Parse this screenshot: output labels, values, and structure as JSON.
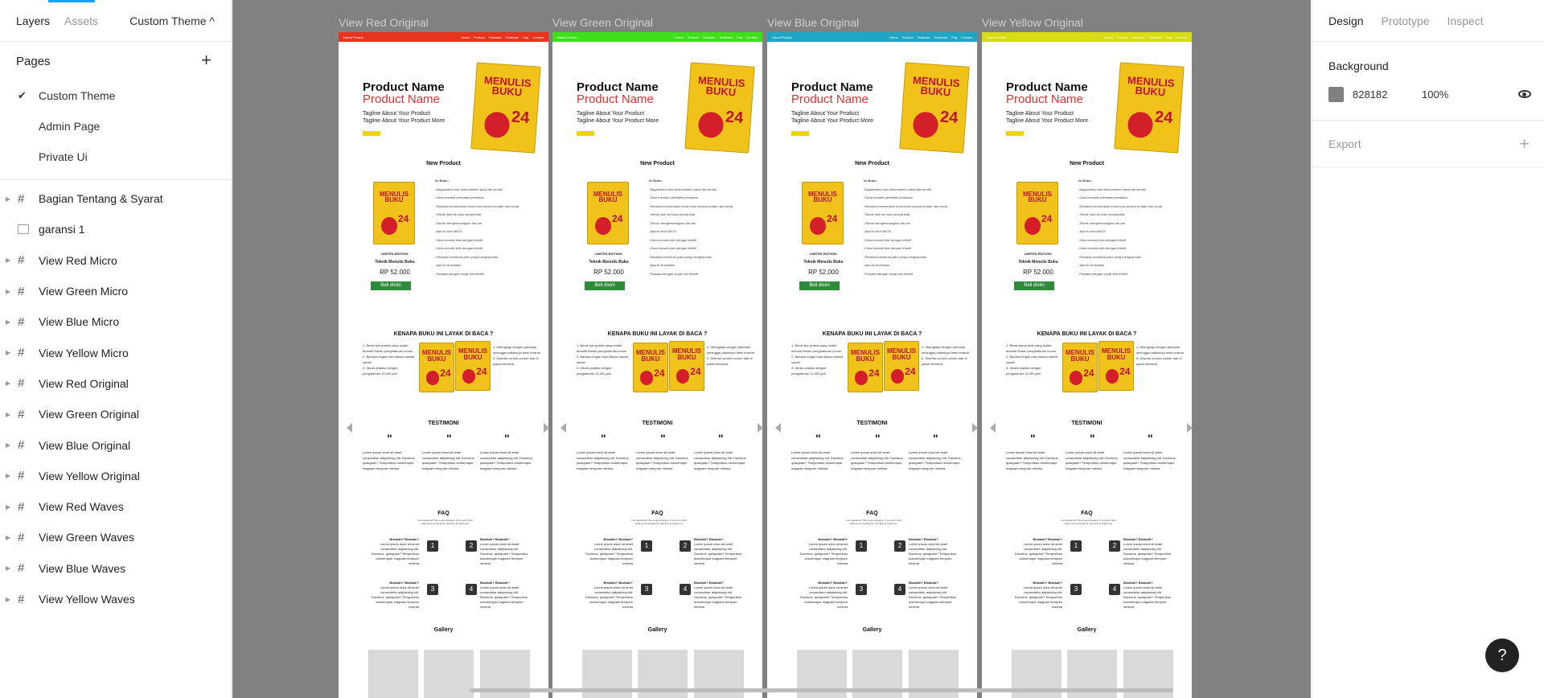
{
  "left_panel": {
    "tabs": [
      "Layers",
      "Assets"
    ],
    "theme_selector": "Custom Theme ^",
    "pages_title": "Pages",
    "pages": [
      "Custom Theme",
      "Admin Page",
      "Private Ui"
    ],
    "layers": [
      {
        "name": "Bagian Tentang & Syarat",
        "icon": "frame-icon"
      },
      {
        "name": "garansi 1",
        "icon": "image-icon"
      },
      {
        "name": "View Red Micro",
        "icon": "frame-icon"
      },
      {
        "name": "View Green Micro",
        "icon": "frame-icon"
      },
      {
        "name": "View Blue Micro",
        "icon": "frame-icon"
      },
      {
        "name": "View Yellow Micro",
        "icon": "frame-icon"
      },
      {
        "name": "View Red Original",
        "icon": "frame-icon"
      },
      {
        "name": "View Green Original",
        "icon": "frame-icon"
      },
      {
        "name": "View Blue Original",
        "icon": "frame-icon"
      },
      {
        "name": "View Yellow Original",
        "icon": "frame-icon"
      },
      {
        "name": "View Red Waves",
        "icon": "frame-icon"
      },
      {
        "name": "View Green Waves",
        "icon": "frame-icon"
      },
      {
        "name": "View Blue Waves",
        "icon": "frame-icon"
      },
      {
        "name": "View Yellow Waves",
        "icon": "frame-icon"
      }
    ]
  },
  "frames": [
    {
      "label": "View Red Original",
      "color": "#e8331f"
    },
    {
      "label": "View Green Original",
      "color": "#3ee01a"
    },
    {
      "label": "View Blue Original",
      "color": "#1fa6c4"
    },
    {
      "label": "View Yellow Original",
      "color": "#d8dc14"
    }
  ],
  "mock": {
    "brand": "Nama Produk",
    "nav": [
      "Home",
      "Product",
      "Features",
      "Testimoni",
      "Faq",
      "Contact"
    ],
    "product_name": "Product Name",
    "tagline_1": "Tagline About Your Product",
    "tagline_2": "Tagline About Your Product More",
    "book_title": "MENULIS BUKU",
    "book_hours": "24",
    "new_product": "New Product",
    "list_title": "Isi Buku:",
    "list": [
      "-Bagaimana cara berkomitmen pada diri sendiri",
      "-Cara menarik perhatian pembaca",
      "-Rahasia menemukan tema buku secara mudah dan cepat",
      "-Teknik riset isi buku secara kilat",
      "-Teknik mengembangkan ide-ide",
      "-Apa itu teori 80/20",
      "-Cara menulis bab dengan efektif",
      "-Cara menulis bab dengan efektif",
      "-Rahasia membuat judul yang menghipnotis",
      "-Apa itu di etalase",
      "-Pustaka dengan cepat dan efektif"
    ],
    "edition": "LIMITED EDITION:",
    "book_name": "Teknik Menulis Buku",
    "price": "RP 52.000",
    "buy": "Beli disini",
    "why_title": "KENAPA BUKU INI LAYAK DI BACA ?",
    "why_left": "1. Berisi tips praktis yang sudah terbukti Bukan pengetahuan umum\n2. Bahasa ringan bisa dibaca sambil santai\n3. Ditulis praktisi dengan pengalaman 10.000 jam",
    "why_right": "4. Dilengkapi dengan panduan sehingga praktisnya lebih terarah\n5. Disertai contoh-contoh bab di pakai referensi",
    "testimoni": "TESTIMONI",
    "testi_text": "Lorem ipsum dolor sit amet consectetur adipisicing elit. Ducimus, quisquam? Temporibus doloremque magnam tempore minima",
    "faq_title": "FAQ",
    "faq_sub": "Got questions? We've got answers. If you don't find what you're looking for, feel free to reach out.",
    "faq_q": "Bisakah? Bisakah?",
    "faq_a": "Lorem ipsum dolor sit amet consectetur adipisicing elit. Ducimus, quisquam? Temporibus doloremque magnam tempore minima",
    "gallery": "Gallery"
  },
  "right_panel": {
    "tabs": [
      "Design",
      "Prototype",
      "Inspect"
    ],
    "background_title": "Background",
    "background_hex": "828182",
    "background_opacity": "100%",
    "export_title": "Export"
  },
  "help_label": "?"
}
